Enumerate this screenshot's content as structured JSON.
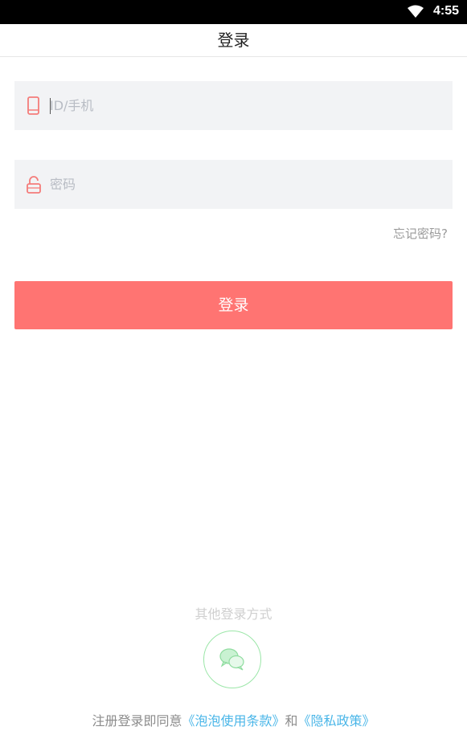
{
  "status_bar": {
    "time": "4:55"
  },
  "header": {
    "title": "登录"
  },
  "form": {
    "id_placeholder": "ID/手机",
    "password_placeholder": "密码",
    "forgot_password": "忘记密码?",
    "login_button": "登录"
  },
  "other_login": {
    "label": "其他登录方式",
    "methods": [
      "wechat-icon"
    ]
  },
  "agreement": {
    "prefix": "注册登录即同意",
    "terms_link": "《泡泡使用条款》",
    "conjunction": "和",
    "privacy_link": "《隐私政策》"
  },
  "colors": {
    "accent": "#ff7472",
    "link": "#4ab6e8",
    "wechat": "#9be6a8",
    "field_bg": "#f2f3f5"
  }
}
